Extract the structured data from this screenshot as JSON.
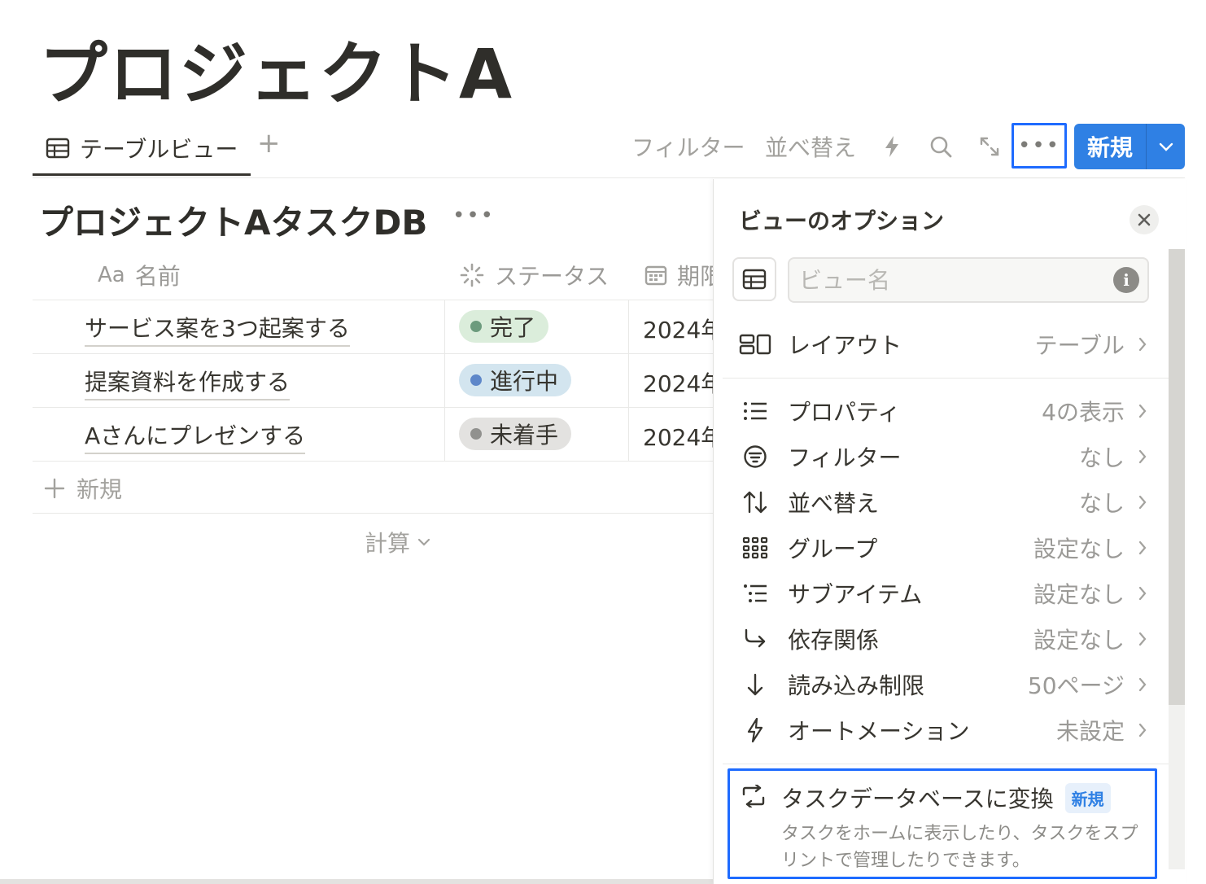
{
  "page": {
    "title": "プロジェクトA"
  },
  "views": {
    "tabs": [
      {
        "label": "テーブルビュー"
      }
    ],
    "add_label": "+"
  },
  "toolbar": {
    "filter_label": "フィルター",
    "sort_label": "並べ替え",
    "more_label": "•••",
    "new_label": "新規"
  },
  "database": {
    "title": "プロジェクトAタスクDB",
    "more_label": "•••",
    "columns": [
      {
        "icon": "text-aa-icon",
        "prefix": "Aa",
        "label": "名前"
      },
      {
        "icon": "status-spinner-icon",
        "label": "ステータス"
      },
      {
        "icon": "calendar-icon",
        "label": "期限"
      }
    ],
    "rows": [
      {
        "name": "サービス案を3つ起案する",
        "status": "完了",
        "status_bg": "#dbeddb",
        "status_dot": "#6c9b7d",
        "date": "2024年"
      },
      {
        "name": "提案資料を作成する",
        "status": "進行中",
        "status_bg": "#d3e5ef",
        "status_dot": "#5e87c9",
        "date": "2024年"
      },
      {
        "name": "Aさんにプレゼンする",
        "status": "未着手",
        "status_bg": "#e3e2e0",
        "status_dot": "#91918e",
        "date": "2024年"
      }
    ],
    "new_row_label": "新規",
    "calc_label": "計算"
  },
  "view_options": {
    "title": "ビューのオプション",
    "view_name_placeholder": "ビュー名",
    "layout": {
      "label": "レイアウト",
      "value": "テーブル"
    },
    "items": [
      {
        "key": "properties",
        "label": "プロパティ",
        "value": "4の表示"
      },
      {
        "key": "filter",
        "label": "フィルター",
        "value": "なし"
      },
      {
        "key": "sort",
        "label": "並べ替え",
        "value": "なし"
      },
      {
        "key": "group",
        "label": "グループ",
        "value": "設定なし"
      },
      {
        "key": "subitems",
        "label": "サブアイテム",
        "value": "設定なし"
      },
      {
        "key": "dependencies",
        "label": "依存関係",
        "value": "設定なし"
      },
      {
        "key": "load_limit",
        "label": "読み込み制限",
        "value": "50ページ"
      },
      {
        "key": "automation",
        "label": "オートメーション",
        "value": "未設定"
      }
    ],
    "convert": {
      "title": "タスクデータベースに変換",
      "badge": "新規",
      "description": "タスクをホームに表示したり、タスクをスプリントで管理したりできます。"
    }
  },
  "colors": {
    "accent": "#2f80e4",
    "highlight": "#1e6bff",
    "text": "#37352f",
    "muted": "#9b9a97"
  }
}
